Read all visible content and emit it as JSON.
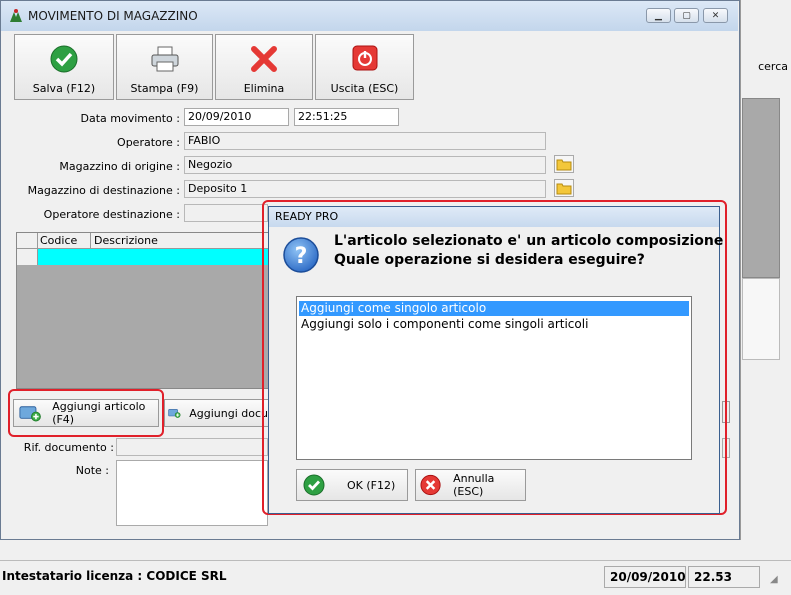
{
  "background_app": {
    "cerca_label": "cerca"
  },
  "window": {
    "title": "MOVIMENTO DI MAGAZZINO"
  },
  "toolbar": {
    "save_label": "Salva (F12)",
    "print_label": "Stampa (F9)",
    "delete_label": "Elimina",
    "exit_label": "Uscita (ESC)"
  },
  "form": {
    "date_label": "Data movimento :",
    "date_value": "20/09/2010",
    "time_value": "22:51:25",
    "operator_label": "Operatore :",
    "operator_value": "FABIO",
    "origin_label": "Magazzino di origine :",
    "origin_value": "Negozio",
    "dest_label": "Magazzino di destinazione :",
    "dest_value": "Deposito 1",
    "dest_operator_label": "Operatore destinazione :",
    "dest_operator_value": ""
  },
  "grid": {
    "col_code": "Codice",
    "col_desc": "Descrizione"
  },
  "bottom": {
    "add_article_label": "Aggiungi articolo (F4)",
    "add_doc_label": "Aggiungi docu",
    "ref_doc_label": "Rif. documento :",
    "notes_label": "Note :"
  },
  "dialog": {
    "title": "READY PRO",
    "message_line1": "L'articolo selezionato e' un articolo composizione",
    "message_line2": "Quale operazione si desidera eseguire?",
    "options": [
      "Aggiungi come singolo articolo",
      "Aggiungi solo i componenti come singoli articoli"
    ],
    "ok_label": "OK (F12)",
    "cancel_label": "Annulla (ESC)"
  },
  "statusbar": {
    "license": "Intestatario licenza : CODICE SRL",
    "date": "20/09/2010",
    "time": "22.53"
  }
}
